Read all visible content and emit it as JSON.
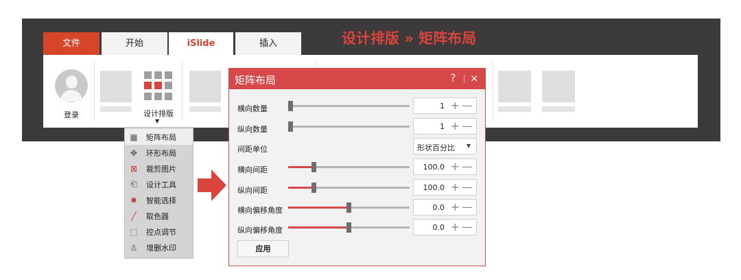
{
  "banner": {
    "title": "设计排版 » 矩阵布局",
    "color": "#d9443c"
  },
  "tabs": [
    {
      "label": "文件"
    },
    {
      "label": "开始"
    },
    {
      "label": "iSlide"
    },
    {
      "label": "插入"
    }
  ],
  "ribbon": {
    "login_label": "登录",
    "design_label": "设计排版",
    "design_caret": "▼"
  },
  "menu": {
    "items": [
      {
        "label": "矩阵布局",
        "icon": "grid-icon"
      },
      {
        "label": "环形布局",
        "icon": "ring-icon"
      },
      {
        "label": "裁剪图片",
        "icon": "crop-icon"
      },
      {
        "label": "设计工具",
        "icon": "brush-icon"
      },
      {
        "label": "智能选择",
        "icon": "star-icon"
      },
      {
        "label": "取色器",
        "icon": "eyedropper-icon"
      },
      {
        "label": "控点调节",
        "icon": "handle-icon"
      },
      {
        "label": "增删水印",
        "icon": "stamp-icon"
      }
    ]
  },
  "dialog": {
    "title": "矩阵布局",
    "help": "?",
    "close": "×",
    "rows": [
      {
        "label": "横向数量",
        "value": "1",
        "slider": 0.0,
        "filled": false
      },
      {
        "label": "纵向数量",
        "value": "1",
        "slider": 0.0,
        "filled": false
      },
      {
        "label": "横向间距",
        "value": "100.0",
        "slider": 0.2,
        "filled": true
      },
      {
        "label": "纵向间距",
        "value": "100.0",
        "slider": 0.2,
        "filled": true
      },
      {
        "label": "横向偏移角度",
        "value": "0.0",
        "slider": 0.5,
        "filled": true
      },
      {
        "label": "纵向偏移角度",
        "value": "0.0",
        "slider": 0.5,
        "filled": true
      }
    ],
    "spacing_unit": {
      "label": "间距单位",
      "value": "形状百分比",
      "caret": "▼"
    },
    "plus": "+",
    "minus": "—",
    "apply_label": "应用",
    "accent": "#d6484a"
  }
}
